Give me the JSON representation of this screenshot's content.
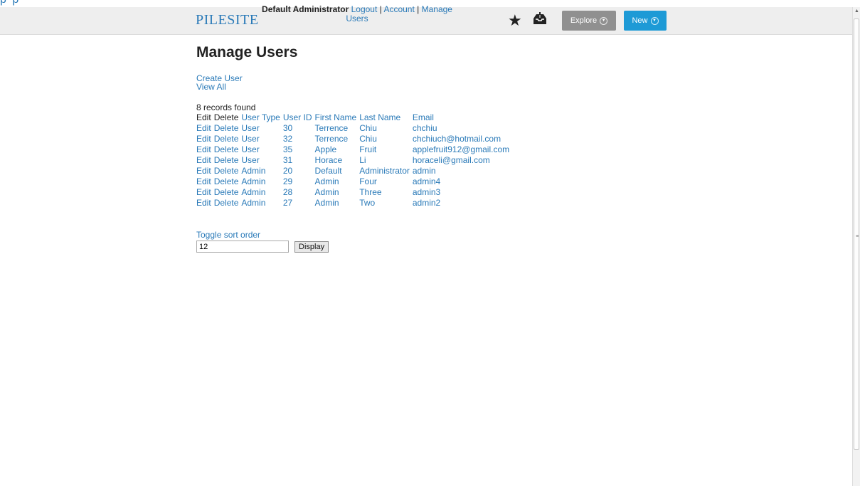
{
  "corner_text": "p    p",
  "header": {
    "logo": "PILESITE",
    "user_name": "Default Administrator",
    "logout": "Logout",
    "account": "Account",
    "manage_users": "Manage Users",
    "explore": "Explore",
    "new": "New",
    "icons": [
      "star-icon",
      "inbox-download-icon"
    ]
  },
  "main": {
    "title": "Manage Users",
    "create_user": "Create User",
    "view_all": "View All",
    "records_found": "8 records found",
    "columns": {
      "edit": "Edit",
      "delete": "Delete",
      "user_type": "User Type",
      "user_id": "User ID",
      "first_name": "First Name",
      "last_name": "Last Name",
      "email": "Email"
    },
    "rows": [
      {
        "edit": "Edit",
        "delete": "Delete",
        "type": "User",
        "id": "30",
        "first": "Terrence",
        "last": "Chiu",
        "email": "chchiu"
      },
      {
        "edit": "Edit",
        "delete": "Delete",
        "type": "User",
        "id": "32",
        "first": "Terrence",
        "last": "Chiu",
        "email": "chchiuch@hotmail.com"
      },
      {
        "edit": "Edit",
        "delete": "Delete",
        "type": "User",
        "id": "35",
        "first": "Apple",
        "last": "Fruit",
        "email": "applefruit912@gmail.com"
      },
      {
        "edit": "Edit",
        "delete": "Delete",
        "type": "User",
        "id": "31",
        "first": "Horace",
        "last": "Li",
        "email": "horaceli@gmail.com"
      },
      {
        "edit": "Edit",
        "delete": "Delete",
        "type": "Admin",
        "id": "20",
        "first": "Default",
        "last": "Administrator",
        "email": "admin"
      },
      {
        "edit": "Edit",
        "delete": "Delete",
        "type": "Admin",
        "id": "29",
        "first": "Admin",
        "last": "Four",
        "email": "admin4"
      },
      {
        "edit": "Edit",
        "delete": "Delete",
        "type": "Admin",
        "id": "28",
        "first": "Admin",
        "last": "Three",
        "email": "admin3"
      },
      {
        "edit": "Edit",
        "delete": "Delete",
        "type": "Admin",
        "id": "27",
        "first": "Admin",
        "last": "Two",
        "email": "admin2"
      }
    ],
    "toggle_sort": "Toggle sort order",
    "display_count": "12",
    "display_button": "Display"
  },
  "colors": {
    "link": "#2a7ab8",
    "new_button": "#1d9ad6",
    "explore_button": "#909090",
    "topbar": "#eeeeee"
  }
}
